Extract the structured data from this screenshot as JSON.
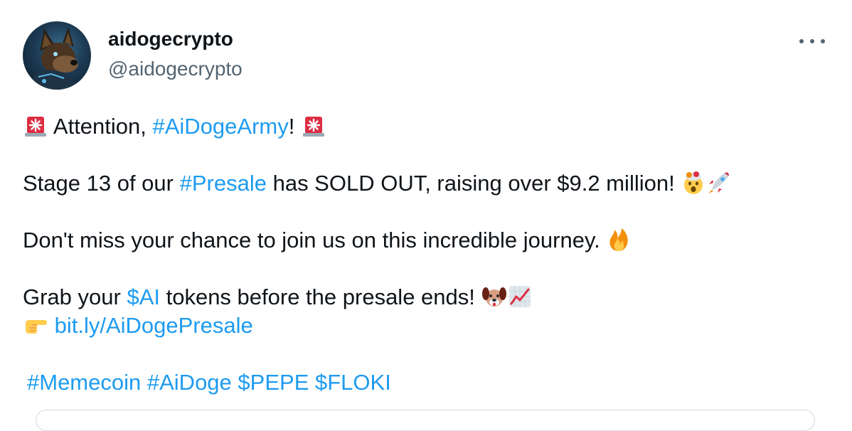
{
  "tweet": {
    "display_name": "aidogecrypto",
    "handle": "@aidogecrypto",
    "more_icon": "more-horizontal-icon",
    "line1": {
      "lead_emoji": "rotating-light-emoji",
      "text_before": " Attention, ",
      "hashtag": "#AiDogeArmy",
      "text_after": "! ",
      "trail_emoji": "rotating-light-emoji"
    },
    "line2": {
      "text_before": "Stage 13 of our ",
      "hashtag": "#Presale",
      "text_after": " has SOLD OUT, raising over $9.2 million! ",
      "emojis": [
        "exploding-head-emoji",
        "rocket-emoji"
      ]
    },
    "line3": {
      "text": "Don't miss your chance to join us on this incredible journey. ",
      "emoji": "fire-emoji"
    },
    "line4": {
      "text_before": "Grab your ",
      "cashtag": "$AI",
      "text_after": " tokens before the presale ends! ",
      "emojis": [
        "dog-face-emoji",
        "chart-increasing-emoji"
      ]
    },
    "line5": {
      "emoji": "backhand-index-pointing-right-emoji",
      "link": "bit.ly/AiDogePresale"
    },
    "tags": [
      "#Memecoin",
      "#AiDoge",
      "$PEPE",
      "$FLOKI"
    ]
  },
  "colors": {
    "text": "#0f1419",
    "secondary": "#536471",
    "link": "#1d9bf0",
    "border": "#cfd9de"
  }
}
